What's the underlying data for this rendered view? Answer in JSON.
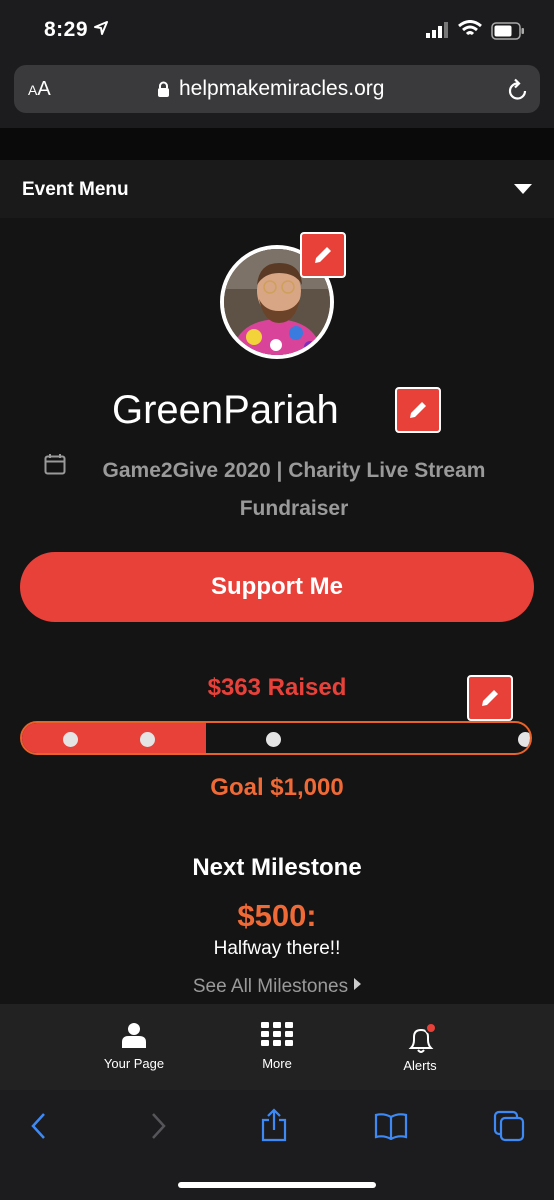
{
  "status_bar": {
    "time": "8:29"
  },
  "browser": {
    "aa_label_big": "A",
    "aa_label_small": "A",
    "url": "helpmakemiracles.org"
  },
  "event_menu": {
    "label": "Event Menu"
  },
  "profile": {
    "username": "GreenPariah",
    "event_title": "Game2Give 2020 | Charity Live Stream Fundraiser"
  },
  "support_button": {
    "label": "Support Me"
  },
  "fundraising": {
    "raised_label": "$363 Raised",
    "raised": 363,
    "goal": 1000,
    "goal_label": "Goal $1,000"
  },
  "milestone": {
    "heading": "Next Milestone",
    "amount": "$500:",
    "description": "Halfway there!!",
    "see_all": "See All Milestones"
  },
  "bottom_nav": {
    "items": [
      {
        "label": "Your Page"
      },
      {
        "label": "More"
      },
      {
        "label": "Alerts"
      }
    ]
  },
  "colors": {
    "accent": "#e8413a",
    "goal_orange": "#ef6a36",
    "safari_blue": "#3d8af7"
  }
}
